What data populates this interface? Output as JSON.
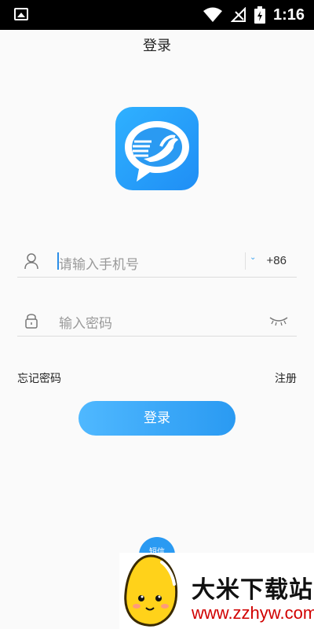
{
  "status_bar": {
    "time": "1:16"
  },
  "header": {
    "title": "登录"
  },
  "logo": {
    "icon": "dove-chat-bubble-logo",
    "color": "#1f8ef5"
  },
  "phone_field": {
    "placeholder": "请输入手机号",
    "country_code": "+86"
  },
  "password_field": {
    "placeholder": "输入密码"
  },
  "links": {
    "forgot_password": "忘记密码",
    "register": "注册"
  },
  "login_button": {
    "label": "登录",
    "color": "#2a9af2"
  },
  "sms_login": {
    "label": "短信"
  },
  "watermark": {
    "name": "大米下载站",
    "url": "www.zzhyw.com"
  }
}
